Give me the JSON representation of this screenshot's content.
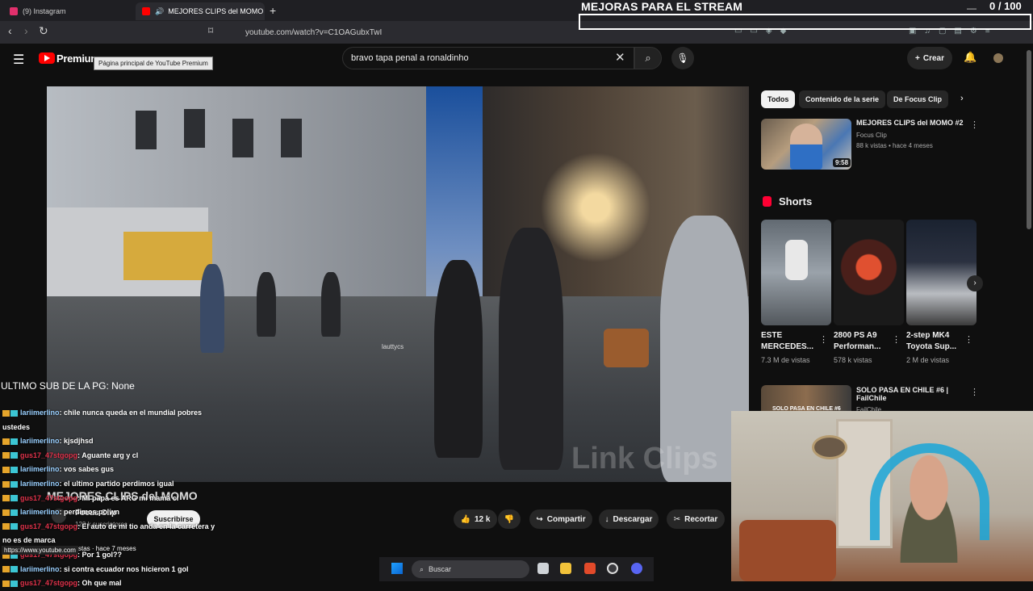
{
  "browser": {
    "tabs": [
      {
        "label": "(9) Instagram",
        "color": "#e1306c"
      },
      {
        "label": "MEJORES CLIPS del MOMO -",
        "color": "#ff0000"
      }
    ],
    "url": "youtube.com/watch?v=C1OAGubxTwI"
  },
  "overlay": {
    "goal_title": "MEJORAS PARA EL STREAM",
    "goal_count": "0 / 100",
    "last_sub": "ULTIMO SUB DE LA PG: None"
  },
  "youtube": {
    "brand": "Premium",
    "tooltip": "Página principal de YouTube Premium",
    "search_value": "bravo tapa penal a ronaldinho",
    "create_label": "Crear"
  },
  "video": {
    "title": "MEJORES CLIPS del MOMO",
    "channel": "Focus Clip",
    "subscribers": "123 k suscriptores",
    "subscribe_label": "Suscribirse",
    "watermark": "Link Clips",
    "inset_text": "lauttycs",
    "likes": "12 k",
    "share_label": "Compartir",
    "download_label": "Descargar",
    "clip_label": "Recortar"
  },
  "sidebar": {
    "chips": [
      "Todos",
      "Contenido de la serie",
      "De Focus Clip"
    ],
    "related": [
      {
        "title": "MEJORES CLIPS del MOMO #2",
        "channel": "Focus Clip",
        "meta": "88 k vistas • hace 4 meses",
        "duration": "9:58"
      },
      {
        "title": "SOLO PASA EN CHILE #6 | FailChile",
        "channel": "FailChile",
        "thumb_text": "SOLO PASA EN CHILE #6"
      }
    ],
    "shorts_title": "Shorts",
    "shorts": [
      {
        "title": "ESTE MERCEDES...",
        "views": "7.3 M de vistas"
      },
      {
        "title": "2800 PS A9 Performan...",
        "views": "578 k vistas"
      },
      {
        "title": "2-step MK4 Toyota Sup...",
        "views": "2 M de vistas"
      }
    ]
  },
  "chat": [
    {
      "user": "lariimerlino",
      "msg": "chile nunca queda en el mundial pobres ustedes",
      "style": "u1"
    },
    {
      "user": "lariimerlino",
      "msg": "kjsdjhsd",
      "style": "u1"
    },
    {
      "user": "gus17_47stgopg",
      "msg": "Aguante arg y cl",
      "style": "u2"
    },
    {
      "user": "lariimerlino",
      "msg": "vos sabes gus",
      "style": "u1"
    },
    {
      "user": "lariimerlino",
      "msg": "el ultimo partido perdimos igual",
      "style": "u1"
    },
    {
      "user": "gus17_47stgopg",
      "msg": "Mi papá es ARG mi mamá cl",
      "style": "u2"
    },
    {
      "user": "lariimerlino",
      "msg": "perdimos po wn",
      "style": "u1"
    },
    {
      "user": "gus17_47stgopg",
      "msg": "El auto de mi tio anda en la carretera y no es de marca",
      "style": "u2"
    },
    {
      "user": "gus17_47stgopg",
      "msg": "Por 1 gol??",
      "style": "u2"
    },
    {
      "user": "lariimerlino",
      "msg": "si contra ecuador nos hicieron 1 gol",
      "style": "u1"
    },
    {
      "user": "gus17_47stgopg",
      "msg": "Oh que mal",
      "style": "u2"
    }
  ],
  "status": {
    "url": "https://www.youtube.com",
    "meta": "stas · hace 7 meses"
  },
  "taskbar": {
    "search_label": "Buscar"
  }
}
